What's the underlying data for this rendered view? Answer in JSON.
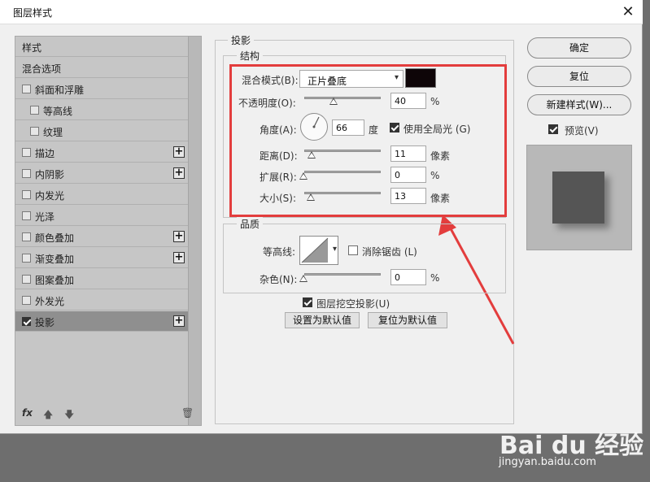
{
  "dialog": {
    "title": "图层样式",
    "close_glyph": "✕"
  },
  "left_list": {
    "items": [
      {
        "label": "样式",
        "checkbox": false,
        "checked": false,
        "plus": false
      },
      {
        "label": "混合选项",
        "checkbox": false,
        "checked": false,
        "plus": false
      },
      {
        "label": "斜面和浮雕",
        "checkbox": true,
        "checked": false,
        "plus": false
      },
      {
        "label": "等高线",
        "checkbox": true,
        "checked": false,
        "plus": false,
        "indent": true
      },
      {
        "label": "纹理",
        "checkbox": true,
        "checked": false,
        "plus": false,
        "indent": true
      },
      {
        "label": "描边",
        "checkbox": true,
        "checked": false,
        "plus": true
      },
      {
        "label": "内阴影",
        "checkbox": true,
        "checked": false,
        "plus": true
      },
      {
        "label": "内发光",
        "checkbox": true,
        "checked": false,
        "plus": false
      },
      {
        "label": "光泽",
        "checkbox": true,
        "checked": false,
        "plus": false
      },
      {
        "label": "颜色叠加",
        "checkbox": true,
        "checked": false,
        "plus": true
      },
      {
        "label": "渐变叠加",
        "checkbox": true,
        "checked": false,
        "plus": true
      },
      {
        "label": "图案叠加",
        "checkbox": true,
        "checked": false,
        "plus": false
      },
      {
        "label": "外发光",
        "checkbox": true,
        "checked": false,
        "plus": false
      },
      {
        "label": "投影",
        "checkbox": true,
        "checked": true,
        "plus": true,
        "selected": true
      }
    ],
    "footer": {
      "fx": "fx",
      "up": "🡅",
      "down": "🡇",
      "trash": "🗑"
    }
  },
  "shadow": {
    "group_title": "投影",
    "structure": {
      "title": "结构",
      "blend_mode_label": "混合模式(B):",
      "blend_mode_value": "正片叠底",
      "color": "#0e0508",
      "opacity_label": "不透明度(O):",
      "opacity_value": "40",
      "opacity_unit": "%",
      "angle_label": "角度(A):",
      "angle_value": "66",
      "angle_unit": "度",
      "global_light_label": "使用全局光 (G)",
      "global_light_checked": true,
      "distance_label": "距离(D):",
      "distance_value": "11",
      "distance_unit": "像素",
      "spread_label": "扩展(R):",
      "spread_value": "0",
      "spread_unit": "%",
      "size_label": "大小(S):",
      "size_value": "13",
      "size_unit": "像素"
    },
    "quality": {
      "title": "品质",
      "contour_label": "等高线:",
      "antialias_label": "消除锯齿 (L)",
      "antialias_checked": false,
      "noise_label": "杂色(N):",
      "noise_value": "0",
      "noise_unit": "%"
    },
    "knockout_label": "图层挖空投影(U)",
    "knockout_checked": true,
    "set_default": "设置为默认值",
    "reset_default": "复位为默认值"
  },
  "right_buttons": {
    "ok": "确定",
    "reset": "复位",
    "new_style": "新建样式(W)...",
    "preview_label": "预览(V)",
    "preview_checked": true
  },
  "colors": {
    "highlight": "#e33d3d"
  },
  "watermark": {
    "brand": "Bai du 经验",
    "url": "jingyan.baidu.com"
  }
}
